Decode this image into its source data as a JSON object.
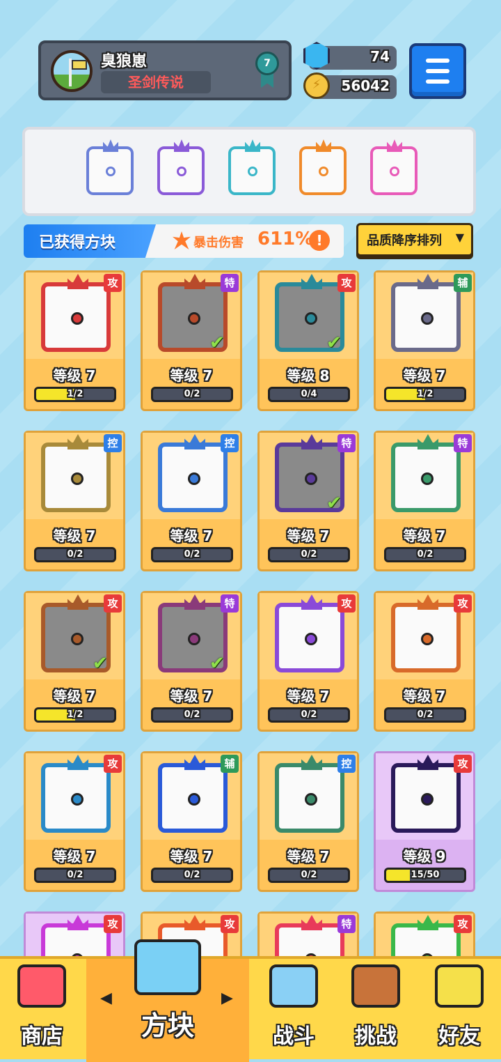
{
  "player": {
    "name": "臭狼崽",
    "title": "圣剑传说",
    "rank": "7"
  },
  "currency": {
    "gems": "74",
    "coins": "56042"
  },
  "section": {
    "title": "已获得方块",
    "crit_label": "暴击伤害",
    "crit_value": "611%",
    "info": "!",
    "sort_label": "品质降序排列",
    "sort_arrow": "▼"
  },
  "equipped": [
    {
      "color": "#6a7fd8"
    },
    {
      "color": "#8a5ad8"
    },
    {
      "color": "#3ab6c8"
    },
    {
      "color": "#f08a2a"
    },
    {
      "color": "#e85ab8"
    }
  ],
  "cards": [
    {
      "tag": "攻",
      "tag_type": "atk",
      "level": "等级 7",
      "progress": "1/2",
      "fill": 0.5,
      "color": "#d83a3a",
      "owned": false,
      "equipped": false
    },
    {
      "tag": "特",
      "tag_type": "spc",
      "level": "等级 7",
      "progress": "0/2",
      "fill": 0,
      "color": "#b84a2a",
      "owned": true,
      "equipped": true
    },
    {
      "tag": "攻",
      "tag_type": "atk",
      "level": "等级 8",
      "progress": "0/4",
      "fill": 0,
      "color": "#2a8a9a",
      "owned": true,
      "equipped": true
    },
    {
      "tag": "辅",
      "tag_type": "sup",
      "level": "等级 7",
      "progress": "1/2",
      "fill": 0.5,
      "color": "#6a6a8a",
      "owned": false,
      "equipped": false
    },
    {
      "tag": "控",
      "tag_type": "ctl",
      "level": "等级 7",
      "progress": "0/2",
      "fill": 0,
      "color": "#a88a3a",
      "owned": false,
      "equipped": false
    },
    {
      "tag": "控",
      "tag_type": "ctl",
      "level": "等级 7",
      "progress": "0/2",
      "fill": 0,
      "color": "#3a7ad8",
      "owned": false,
      "equipped": false
    },
    {
      "tag": "特",
      "tag_type": "spc",
      "level": "等级 7",
      "progress": "0/2",
      "fill": 0,
      "color": "#5a3a9a",
      "owned": true,
      "equipped": true
    },
    {
      "tag": "特",
      "tag_type": "spc",
      "level": "等级 7",
      "progress": "0/2",
      "fill": 0,
      "color": "#3a9a6a",
      "owned": false,
      "equipped": false
    },
    {
      "tag": "攻",
      "tag_type": "atk",
      "level": "等级 7",
      "progress": "1/2",
      "fill": 0.5,
      "color": "#a85a2a",
      "owned": true,
      "equipped": true
    },
    {
      "tag": "特",
      "tag_type": "spc",
      "level": "等级 7",
      "progress": "0/2",
      "fill": 0,
      "color": "#8a3a7a",
      "owned": true,
      "equipped": true
    },
    {
      "tag": "攻",
      "tag_type": "atk",
      "level": "等级 7",
      "progress": "0/2",
      "fill": 0,
      "color": "#8a4ad8",
      "owned": false,
      "equipped": false
    },
    {
      "tag": "攻",
      "tag_type": "atk",
      "level": "等级 7",
      "progress": "0/2",
      "fill": 0,
      "color": "#d86a2a",
      "owned": false,
      "equipped": false
    },
    {
      "tag": "攻",
      "tag_type": "atk",
      "level": "等级 7",
      "progress": "0/2",
      "fill": 0,
      "color": "#2a8ac8",
      "owned": false,
      "equipped": false
    },
    {
      "tag": "辅",
      "tag_type": "sup",
      "level": "等级 7",
      "progress": "0/2",
      "fill": 0,
      "color": "#2a5ad8",
      "owned": false,
      "equipped": false
    },
    {
      "tag": "控",
      "tag_type": "ctl",
      "level": "等级 7",
      "progress": "0/2",
      "fill": 0,
      "color": "#3a8a6a",
      "owned": false,
      "equipped": false
    },
    {
      "tag": "攻",
      "tag_type": "atk",
      "level": "等级 9",
      "progress": "15/50",
      "fill": 0.3,
      "color": "#2a1a5a",
      "owned": false,
      "equipped": false,
      "purple": true
    },
    {
      "tag": "攻",
      "tag_type": "atk",
      "level": "",
      "progress": "",
      "fill": 0,
      "color": "#c83ad8",
      "owned": false,
      "equipped": false,
      "purple": true
    },
    {
      "tag": "攻",
      "tag_type": "atk",
      "level": "",
      "progress": "",
      "fill": 0,
      "color": "#e85a2a",
      "owned": false,
      "equipped": false
    },
    {
      "tag": "特",
      "tag_type": "spc",
      "level": "",
      "progress": "",
      "fill": 0,
      "color": "#e83a5a",
      "owned": false,
      "equipped": false
    },
    {
      "tag": "攻",
      "tag_type": "atk",
      "level": "",
      "progress": "",
      "fill": 0,
      "color": "#3ab84a",
      "owned": false,
      "equipped": false
    }
  ],
  "nav": {
    "shop": "商店",
    "blocks": "方块",
    "battle": "战斗",
    "challenge": "挑战",
    "friends": "好友",
    "prev": "◀",
    "next": "▶"
  }
}
